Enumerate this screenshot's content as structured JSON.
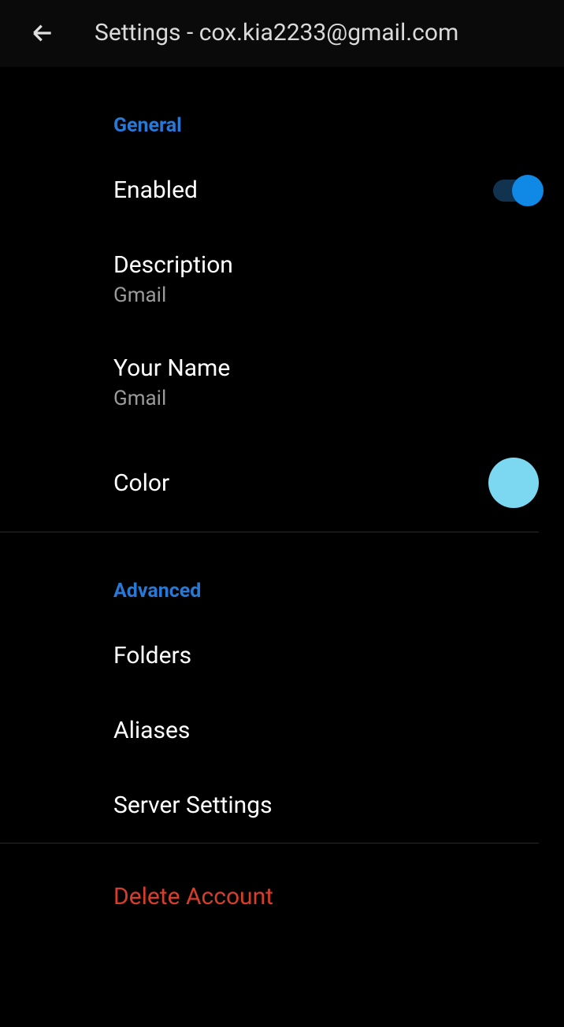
{
  "header": {
    "title": "Settings - cox.kia2233@gmail.com"
  },
  "sections": {
    "general": {
      "label": "General",
      "enabled": {
        "label": "Enabled",
        "value": true
      },
      "description": {
        "label": "Description",
        "value": "Gmail"
      },
      "yourName": {
        "label": "Your Name",
        "value": "Gmail"
      },
      "color": {
        "label": "Color",
        "value": "#7cd7f1"
      }
    },
    "advanced": {
      "label": "Advanced",
      "folders": {
        "label": "Folders"
      },
      "aliases": {
        "label": "Aliases"
      },
      "serverSettings": {
        "label": "Server Settings"
      }
    },
    "delete": {
      "label": "Delete Account"
    }
  }
}
